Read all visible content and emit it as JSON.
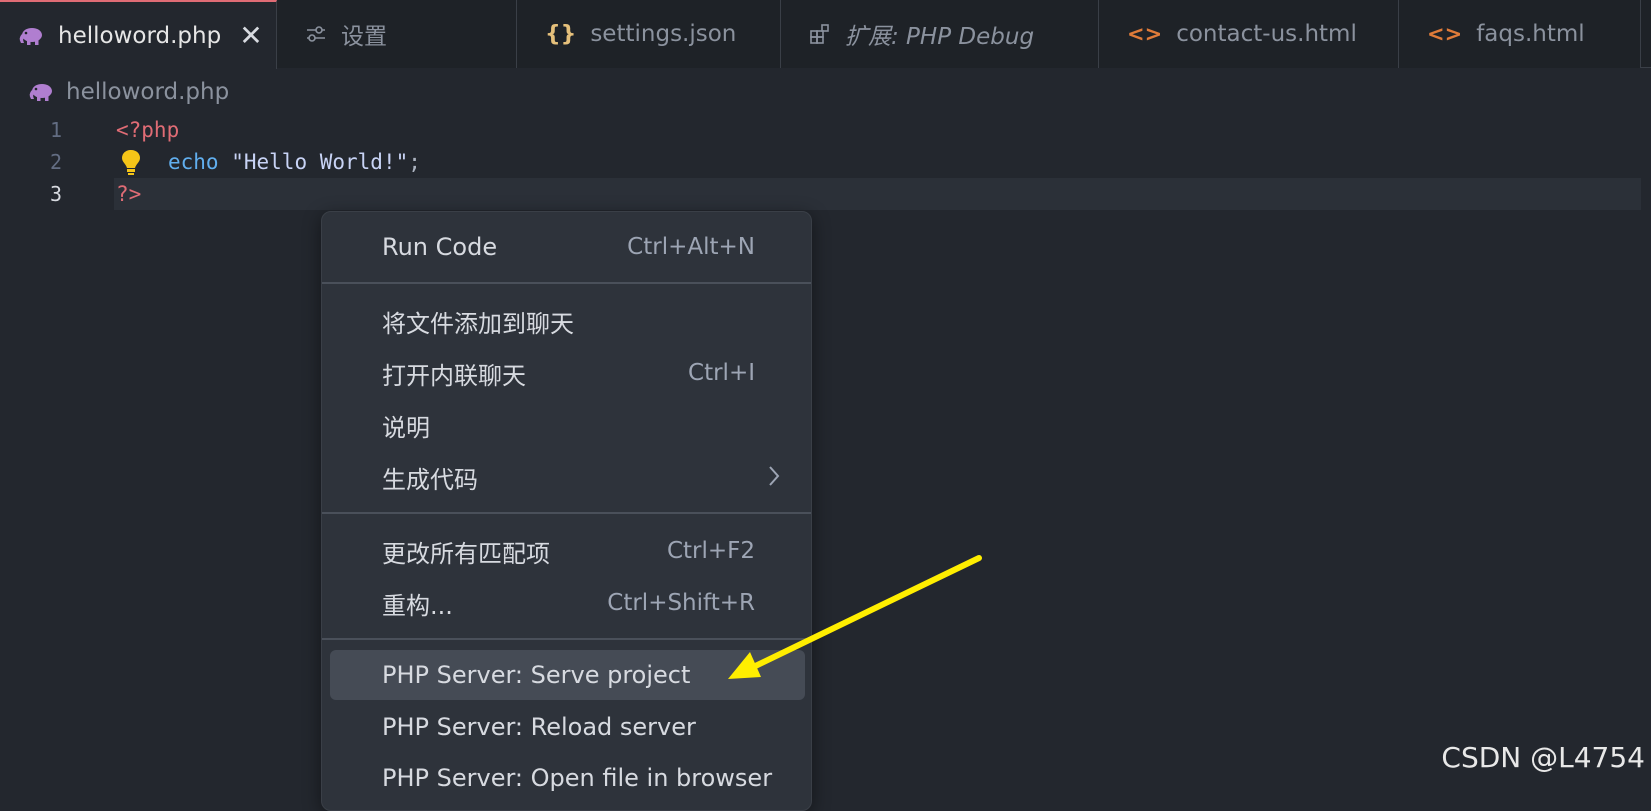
{
  "tabs": [
    {
      "label": "helloword.php",
      "icon": "php-elephant-icon",
      "active": true,
      "close": "✕"
    },
    {
      "label": "设置",
      "icon": "settings-sliders-icon"
    },
    {
      "label": "settings.json",
      "icon": "json-braces-icon",
      "glyph": "{}"
    },
    {
      "label": "扩展: PHP Debug",
      "icon": "extensions-icon",
      "italic": true
    },
    {
      "label": "contact-us.html",
      "icon": "html-code-icon",
      "glyph": "<>"
    },
    {
      "label": "faqs.html",
      "icon": "html-code-icon",
      "glyph": "<>"
    }
  ],
  "breadcrumb": {
    "file": "helloword.php",
    "icon": "php-elephant-icon"
  },
  "editor": {
    "lines": [
      {
        "num": "1",
        "open_tag": "<?php"
      },
      {
        "num": "2",
        "keyword": "echo",
        "string": "\"Hello World!\"",
        "semicolon": ";"
      },
      {
        "num": "3",
        "close_tag": "?>"
      }
    ],
    "lightbulb_icon": "lightbulb-icon"
  },
  "context_menu": {
    "groups": [
      [
        {
          "label": "Run Code",
          "shortcut": "Ctrl+Alt+N"
        }
      ],
      [
        {
          "label": "将文件添加到聊天",
          "shortcut": ""
        },
        {
          "label": "打开内联聊天",
          "shortcut": "Ctrl+I"
        },
        {
          "label": "说明",
          "shortcut": ""
        },
        {
          "label": "生成代码",
          "shortcut": "",
          "submenu": true
        }
      ],
      [
        {
          "label": "更改所有匹配项",
          "shortcut": "Ctrl+F2"
        },
        {
          "label": "重构...",
          "shortcut": "Ctrl+Shift+R"
        }
      ],
      [
        {
          "label": "PHP Server: Serve project",
          "shortcut": "",
          "hovered": true
        },
        {
          "label": "PHP Server: Reload server",
          "shortcut": ""
        },
        {
          "label": "PHP Server: Open file in browser",
          "shortcut": ""
        }
      ]
    ]
  },
  "annotation": {
    "arrow_color": "#ffee00"
  },
  "watermark": "CSDN @L4754",
  "colors": {
    "background": "#23272e",
    "tabbar": "#1e2227",
    "menu": "#2e333b",
    "php_tag": "#e06c75",
    "keyword": "#61afef",
    "json_icon": "#e5c07b",
    "html_icon": "#e07b39",
    "php_icon": "#b07ed0"
  }
}
